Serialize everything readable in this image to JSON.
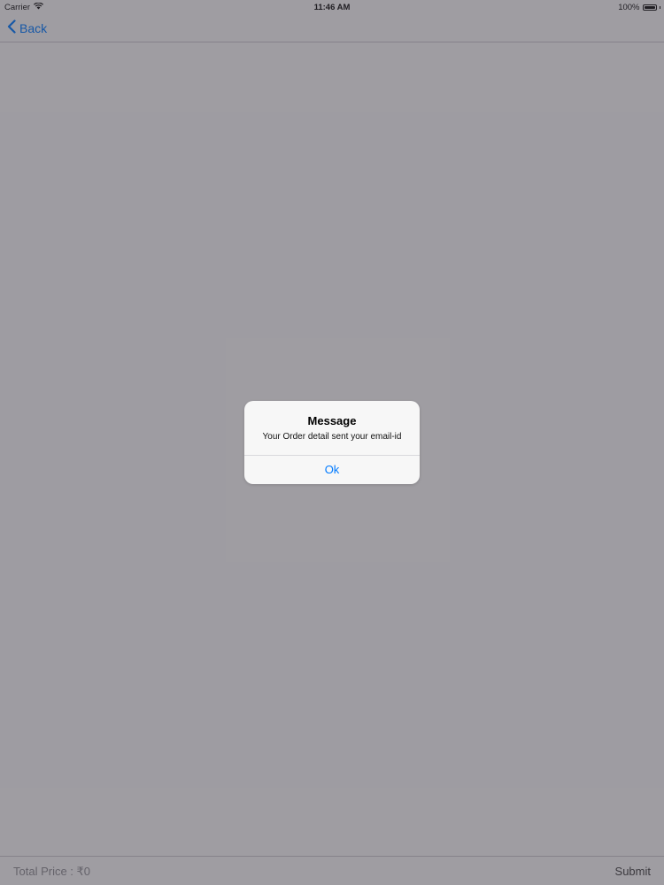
{
  "status_bar": {
    "carrier": "Carrier",
    "time": "11:46 AM",
    "battery": "100%"
  },
  "nav": {
    "back_label": "Back"
  },
  "bottom_bar": {
    "total_price": "Total Price : ₹0",
    "submit_label": "Submit"
  },
  "alert": {
    "title": "Message",
    "message": "Your Order detail sent your email-id",
    "ok_label": "Ok"
  },
  "colors": {
    "accent": "#007aff",
    "dim": "#8e8c93"
  },
  "icons": {
    "wifi": "wifi-icon",
    "battery": "battery-icon",
    "back": "chevron-left-icon"
  }
}
